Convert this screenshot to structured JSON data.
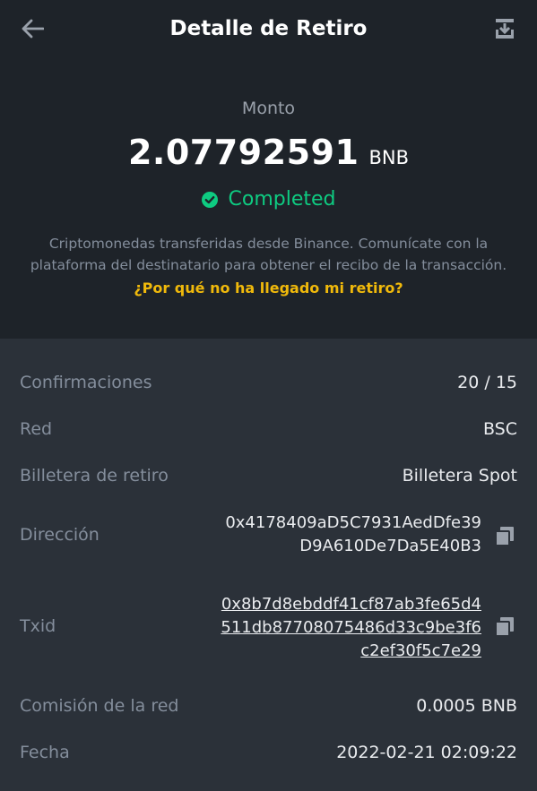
{
  "header": {
    "title": "Detalle de Retiro",
    "back_icon": "arrow-left-icon",
    "download_icon": "download-icon"
  },
  "summary": {
    "amount_label": "Monto",
    "amount": "2.07792591",
    "unit": "BNB",
    "status": "Completed",
    "status_icon": "check-circle-icon",
    "notice": "Criptomonedas transferidas desde Binance. Comunícate con la plataforma del destinatario para obtener el recibo de la transacción.",
    "help_link": "¿Por qué no ha llegado mi retiro?"
  },
  "details": {
    "confirmations": {
      "label": "Confirmaciones",
      "value": "20 / 15"
    },
    "network": {
      "label": "Red",
      "value": "BSC"
    },
    "wallet": {
      "label": "Billetera de retiro",
      "value": "Billetera Spot"
    },
    "address": {
      "label": "Dirección",
      "lines": [
        "0x4178409aD5C7931AedDfe39",
        "D9A610De7Da5E40B3"
      ]
    },
    "txid": {
      "label": "Txid",
      "lines": [
        "0x8b7d8ebddf41cf87ab3fe65d4",
        "511db87708075486d33c9be3f6",
        "c2ef30f5c7e29"
      ]
    },
    "fee": {
      "label": "Comisión de la red",
      "value": "0.0005 BNB"
    },
    "date": {
      "label": "Fecha",
      "value": "2022-02-21 02:09:22"
    }
  },
  "colors": {
    "top_background": "#1e2329",
    "bottom_background": "#2b3139",
    "accent_yellow": "#f0b90b",
    "success_green": "#0ecb81"
  }
}
